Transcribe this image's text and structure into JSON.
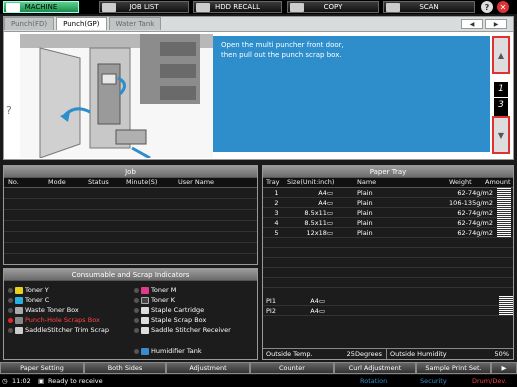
{
  "topbar": {
    "machine": "MACHINE",
    "job_list": "JOB LIST",
    "hdd_recall": "HDD RECALL",
    "copy": "COPY",
    "scan": "SCAN",
    "help": "?",
    "close": "✕"
  },
  "tabs": [
    "Punch(FD)",
    "Punch(GP)",
    "Water Tank"
  ],
  "nav": {
    "prev": "◀",
    "next": "▶"
  },
  "instruction": {
    "line1": "Open the multi puncher front door,",
    "line2": "then pull out the punch scrap box.",
    "help": "?"
  },
  "pager": {
    "up": "▲",
    "down": "▼",
    "current": "1",
    "total": "3"
  },
  "job": {
    "title": "Job",
    "columns": [
      "No.",
      "Mode",
      "Status",
      "Minute(S)",
      "User Name"
    ]
  },
  "paper_tray": {
    "title": "Paper Tray",
    "columns": [
      "Tray",
      "Size(Unit:inch)",
      "Name",
      "Weight",
      "Amount"
    ],
    "rows": [
      {
        "tray": "1",
        "size": "A4▭",
        "name": "Plain",
        "weight": "62-74g/m2"
      },
      {
        "tray": "2",
        "size": "A4▭",
        "name": "Plain",
        "weight": "106-135g/m2"
      },
      {
        "tray": "3",
        "size": "8.5x11▭",
        "name": "Plain",
        "weight": "62-74g/m2"
      },
      {
        "tray": "4",
        "size": "8.5x11▭",
        "name": "Plain",
        "weight": "62-74g/m2"
      },
      {
        "tray": "5",
        "size": "12x18▭",
        "name": "Plain",
        "weight": "62-74g/m2"
      }
    ],
    "pi_rows": [
      {
        "tray": "PI1",
        "size": "A4▭"
      },
      {
        "tray": "PI2",
        "size": "A4▭"
      }
    ],
    "outside_temp_label": "Outside Temp.",
    "outside_temp_value": "25Degrees",
    "outside_humidity_label": "Outside Humidity",
    "outside_humidity_value": "50%"
  },
  "consumables": {
    "title": "Consumable and Scrap Indicators",
    "left": [
      "Toner Y",
      "Toner C",
      "Waste Toner Box",
      "Punch-Hole Scraps Box",
      "SaddleStitcher Trim Scrap"
    ],
    "right": [
      "Toner M",
      "Toner K",
      "Staple Cartridge",
      "Staple Scrap Box",
      "Saddle Stitcher Receiver"
    ],
    "extra": "Humidifier Tank"
  },
  "bottom": [
    "Paper Setting",
    "Both Sides",
    "Adjustment",
    "Counter",
    "Curl Adjustment",
    "Sample Print Set."
  ],
  "status": {
    "time": "11:02",
    "state": "Ready to receive",
    "rotation": "Rotation",
    "security": "Security",
    "drum": "Drum/Dev."
  }
}
